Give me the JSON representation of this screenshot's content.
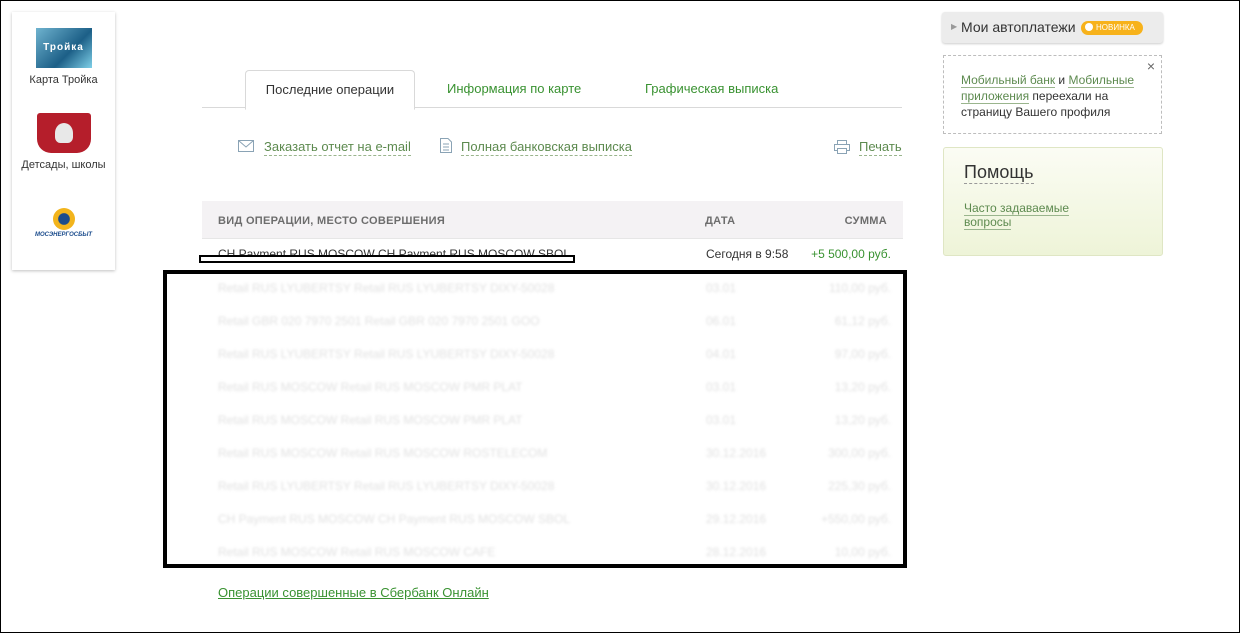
{
  "left_panel": {
    "items": [
      {
        "label": "Карта Тройка",
        "logo_text": "Тройка",
        "icon": "troika-card-icon"
      },
      {
        "label": "Детсады, школы",
        "icon": "moscow-coat-of-arms-icon"
      },
      {
        "label": "",
        "logo_text": "МОСЭНЕРГОСБЫТ",
        "icon": "mosenergosbyt-logo-icon"
      }
    ]
  },
  "tabs": [
    {
      "label": "Последние операции",
      "active": true
    },
    {
      "label": "Информация по карте",
      "active": false
    },
    {
      "label": "Графическая выписка",
      "active": false
    }
  ],
  "actions": {
    "email_report": "Заказать отчет на e-mail",
    "full_statement": "Полная банковская выписка",
    "print": "Печать"
  },
  "table": {
    "headers": {
      "operation": "ВИД ОПЕРАЦИИ, МЕСТО СОВЕРШЕНИЯ",
      "date": "ДАТА",
      "amount": "СУММА"
    },
    "rows": [
      {
        "operation": "CH Payment RUS MOSCOW CH Payment RUS MOSCOW SBOL",
        "date": "Сегодня в 9:58",
        "amount": "+5 500,00 руб."
      },
      {
        "operation": "Retail RUS LYUBERTSY Retail RUS LYUBERTSY DIXY-50028",
        "date": "03.01",
        "amount": "110,00 руб."
      },
      {
        "operation": "Retail GBR 020 7970 2501 Retail GBR 020 7970 2501 GOO",
        "date": "06.01",
        "amount": "61,12 руб."
      },
      {
        "operation": "Retail RUS LYUBERTSY Retail RUS LYUBERTSY DIXY-50028",
        "date": "04.01",
        "amount": "97,00 руб."
      },
      {
        "operation": "Retail RUS MOSCOW Retail RUS MOSCOW PMR PLAT",
        "date": "03.01",
        "amount": "13,20 руб."
      },
      {
        "operation": "Retail RUS MOSCOW Retail RUS MOSCOW PMR PLAT",
        "date": "03.01",
        "amount": "13,20 руб."
      },
      {
        "operation": "Retail RUS MOSCOW Retail RUS MOSCOW ROSTELECOM",
        "date": "30.12.2016",
        "amount": "300,00 руб."
      },
      {
        "operation": "Retail RUS LYUBERTSY Retail RUS LYUBERTSY DIXY-50028",
        "date": "30.12.2016",
        "amount": "225,30 руб."
      },
      {
        "operation": "CH Payment RUS MOSCOW CH Payment RUS MOSCOW SBOL",
        "date": "29.12.2016",
        "amount": "+550,00 руб."
      },
      {
        "operation": "Retail RUS MOSCOW Retail RUS MOSCOW CAFE",
        "date": "28.12.2016",
        "amount": "10,00 руб."
      }
    ]
  },
  "bottom_link": "Операции совершенные в Сбербанк Онлайн",
  "autopay": {
    "title": "Мои автоплатежи",
    "badge": "НОВИНКА"
  },
  "notice": {
    "link1": "Мобильный банк",
    "and": " и ",
    "link2": "Мобильные приложения",
    "rest": " переехали на страницу Вашего профиля",
    "close": "×"
  },
  "help": {
    "title": "Помощь",
    "faq": "Часто задаваемые вопросы"
  },
  "colors": {
    "link_green": "#399231",
    "badge_orange": "#f7b21b",
    "positive_amount": "#399231"
  }
}
